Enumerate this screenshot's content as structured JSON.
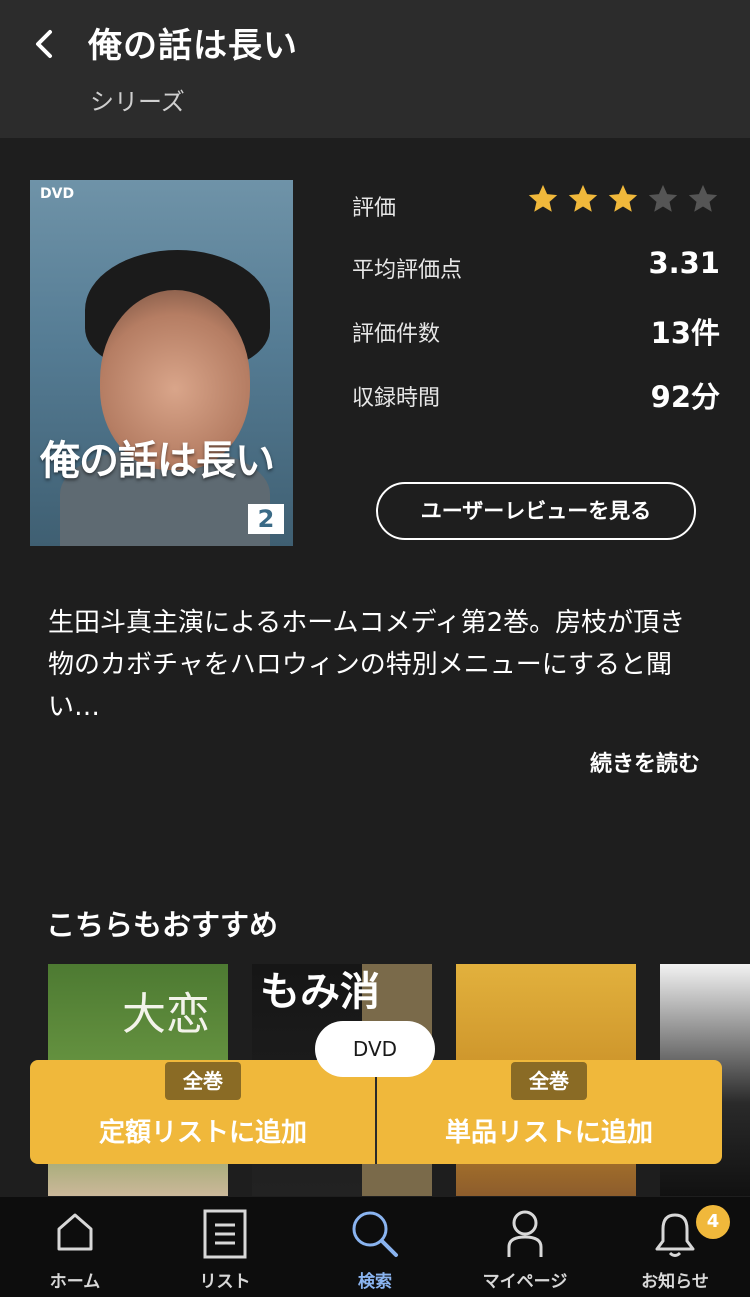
{
  "header": {
    "title": "俺の話は長い",
    "subtitle": "シリーズ"
  },
  "cover": {
    "badge": "DVD",
    "title": "俺の話は長い",
    "volume": "2"
  },
  "info": {
    "rating_label": "評価",
    "rating_stars": 3,
    "rating_max": 5,
    "avg_label": "平均評価点",
    "avg_value": "3.31",
    "count_label": "評価件数",
    "count_value": "13件",
    "duration_label": "収録時間",
    "duration_value": "92分",
    "review_button": "ユーザーレビューを見る"
  },
  "description": {
    "text": "生田斗真主演によるホームコメディ第2巻。房枝が頂き物のカボチャをハロウィンの特別メニューにすると聞い…",
    "read_more": "続きを読む"
  },
  "recommend": {
    "title": "こちらもおすすめ",
    "items": [
      {
        "text": "大恋"
      },
      {
        "text": "もみ消"
      },
      {
        "text": ""
      },
      {
        "text": ""
      }
    ]
  },
  "format_pill": "DVD",
  "add": {
    "left_badge": "全巻",
    "left_label": "定額リストに追加",
    "right_badge": "全巻",
    "right_label": "単品リストに追加"
  },
  "nav": {
    "home": "ホーム",
    "list": "リスト",
    "search": "検索",
    "mypage": "マイページ",
    "notice": "お知らせ",
    "notice_count": "4"
  },
  "colors": {
    "accent": "#f0b83b",
    "star_on": "#f0b83b",
    "star_off": "#555555",
    "nav_active": "#8ab4f0"
  }
}
